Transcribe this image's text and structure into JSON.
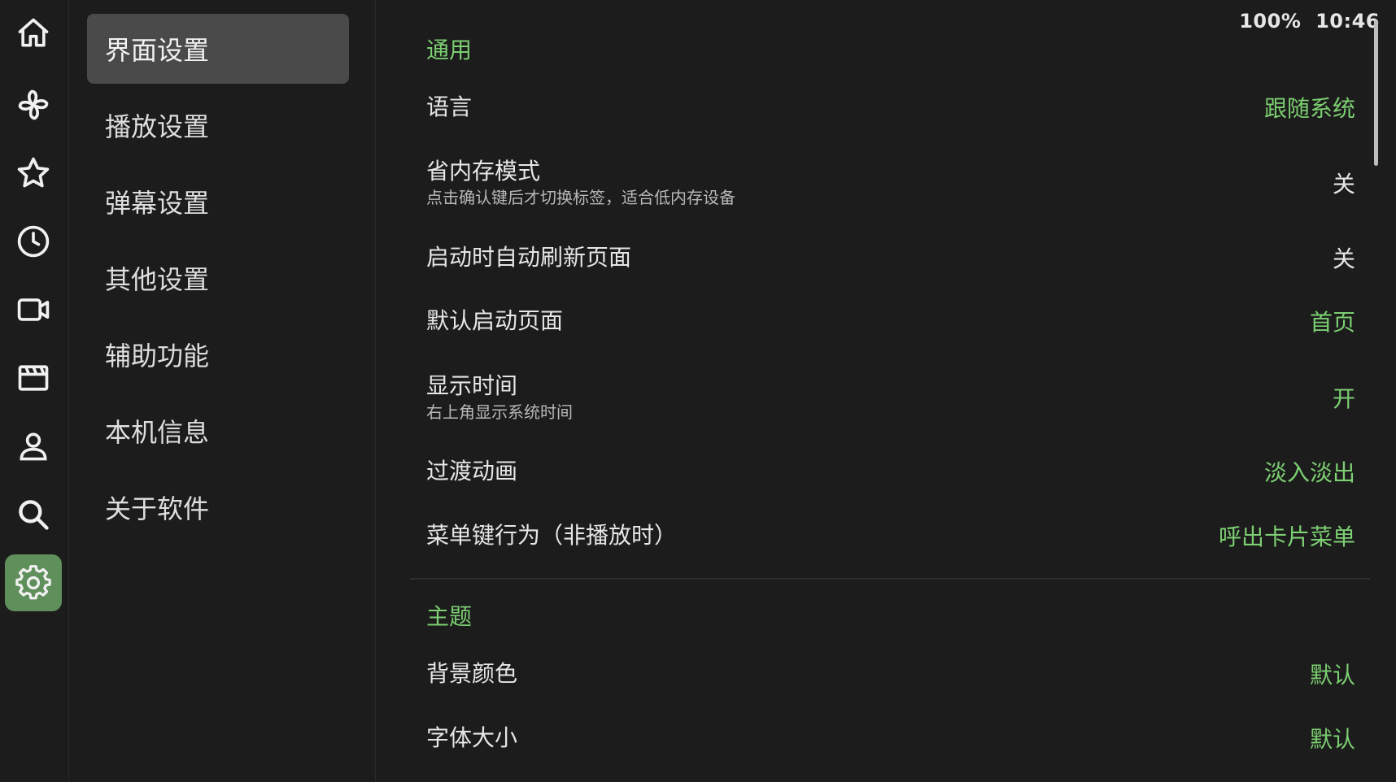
{
  "status_bar": {
    "battery": "100%",
    "time": "10:46"
  },
  "rail": {
    "items": [
      {
        "icon": "home-icon"
      },
      {
        "icon": "pinwheel-icon"
      },
      {
        "icon": "star-icon"
      },
      {
        "icon": "clock-icon"
      },
      {
        "icon": "video-camera-icon"
      },
      {
        "icon": "clapperboard-icon"
      },
      {
        "icon": "user-icon"
      },
      {
        "icon": "search-icon"
      },
      {
        "icon": "gear-icon",
        "active": true
      }
    ],
    "accent": "#5f8f5a"
  },
  "menu": {
    "items": [
      {
        "label": "界面设置",
        "active": true
      },
      {
        "label": "播放设置"
      },
      {
        "label": "弹幕设置"
      },
      {
        "label": "其他设置"
      },
      {
        "label": "辅助功能"
      },
      {
        "label": "本机信息"
      },
      {
        "label": "关于软件"
      }
    ]
  },
  "settings": {
    "sections": [
      {
        "title": "通用",
        "rows": [
          {
            "title": "语言",
            "value": "跟随系统",
            "value_color": "green"
          },
          {
            "title": "省内存模式",
            "subtitle": "点击确认键后才切换标签，适合低内存设备",
            "value": "关",
            "value_color": "white"
          },
          {
            "title": "启动时自动刷新页面",
            "value": "关",
            "value_color": "white"
          },
          {
            "title": "默认启动页面",
            "value": "首页",
            "value_color": "green"
          },
          {
            "title": "显示时间",
            "subtitle": "右上角显示系统时间",
            "value": "开",
            "value_color": "green"
          },
          {
            "title": "过渡动画",
            "value": "淡入淡出",
            "value_color": "green"
          },
          {
            "title": "菜单键行为（非播放时）",
            "value": "呼出卡片菜单",
            "value_color": "green"
          }
        ]
      },
      {
        "title": "主题",
        "rows": [
          {
            "title": "背景颜色",
            "value": "默认",
            "value_color": "green"
          },
          {
            "title": "字体大小",
            "value": "默认",
            "value_color": "green"
          }
        ]
      }
    ]
  },
  "colors": {
    "background": "#1c1c1c",
    "accent_green": "#7ccf72",
    "menu_active": "#4a4a4a"
  }
}
